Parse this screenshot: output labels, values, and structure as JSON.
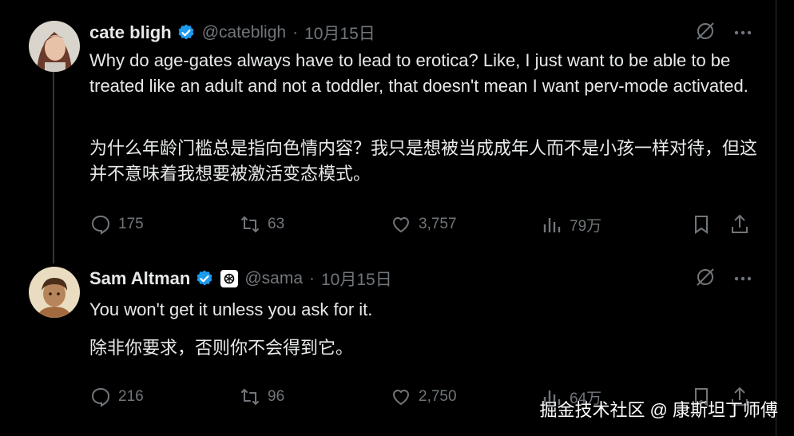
{
  "tweets": [
    {
      "name": "cate bligh",
      "handle": "@catebligh",
      "date": "10月15日",
      "text_en": "Why do age-gates always have to lead to erotica? Like, I just want to be able to be treated like an adult and not a toddler, that doesn't mean I want perv-mode activated.",
      "text_zh": "为什么年龄门槛总是指向色情内容？我只是想被当成成年人而不是小孩一样对待，但这并不意味着我想要被激活变态模式。",
      "replies": "175",
      "retweets": "63",
      "likes": "3,757",
      "views": "79万"
    },
    {
      "name": "Sam Altman",
      "handle": "@sama",
      "date": "10月15日",
      "text_en": "You won't get it unless you ask for it.",
      "text_zh": "除非你要求，否则你不会得到它。",
      "replies": "216",
      "retweets": "96",
      "likes": "2,750",
      "views": "64万"
    }
  ],
  "separator": "·",
  "watermark": "掘金技术社区 @ 康斯坦丁师傅",
  "colors": {
    "background": "#000000",
    "text": "#e7e9ea",
    "muted": "#71767b",
    "verified": "#1d9bf0"
  }
}
